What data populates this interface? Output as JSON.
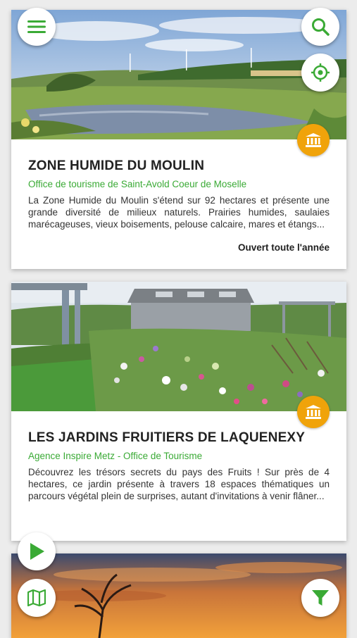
{
  "cards": [
    {
      "title": "ZONE HUMIDE DU MOULIN",
      "organization": "Office de tourisme de Saint-Avold Coeur de Moselle",
      "description": "La Zone Humide du Moulin s'étend sur 92 hectares et présente une grande diversité de milieux naturels. Prairies humides, saulaies marécageuses, vieux boisements, pelouse calcaire, mares et étangs...",
      "hours": "Ouvert toute l'année",
      "badge_icon": "museum-icon"
    },
    {
      "title": "LES JARDINS FRUITIERS DE LAQUENEXY",
      "organization": "Agence Inspire Metz - Office de Tourisme",
      "description": "Découvrez les trésors secrets du pays des Fruits ! Sur près de 4 hectares, ce jardin présente à travers 18 espaces thématiques un parcours végétal plein de surprises, autant d'invitations à venir flâner...",
      "badge_icon": "museum-icon"
    }
  ],
  "fabs": {
    "menu": "menu-icon",
    "search": "search-icon",
    "locate": "crosshair-icon",
    "play": "play-icon",
    "map": "map-icon",
    "filter": "filter-icon"
  },
  "colors": {
    "accent": "#3aaa35",
    "badge": "#f0a30a"
  }
}
